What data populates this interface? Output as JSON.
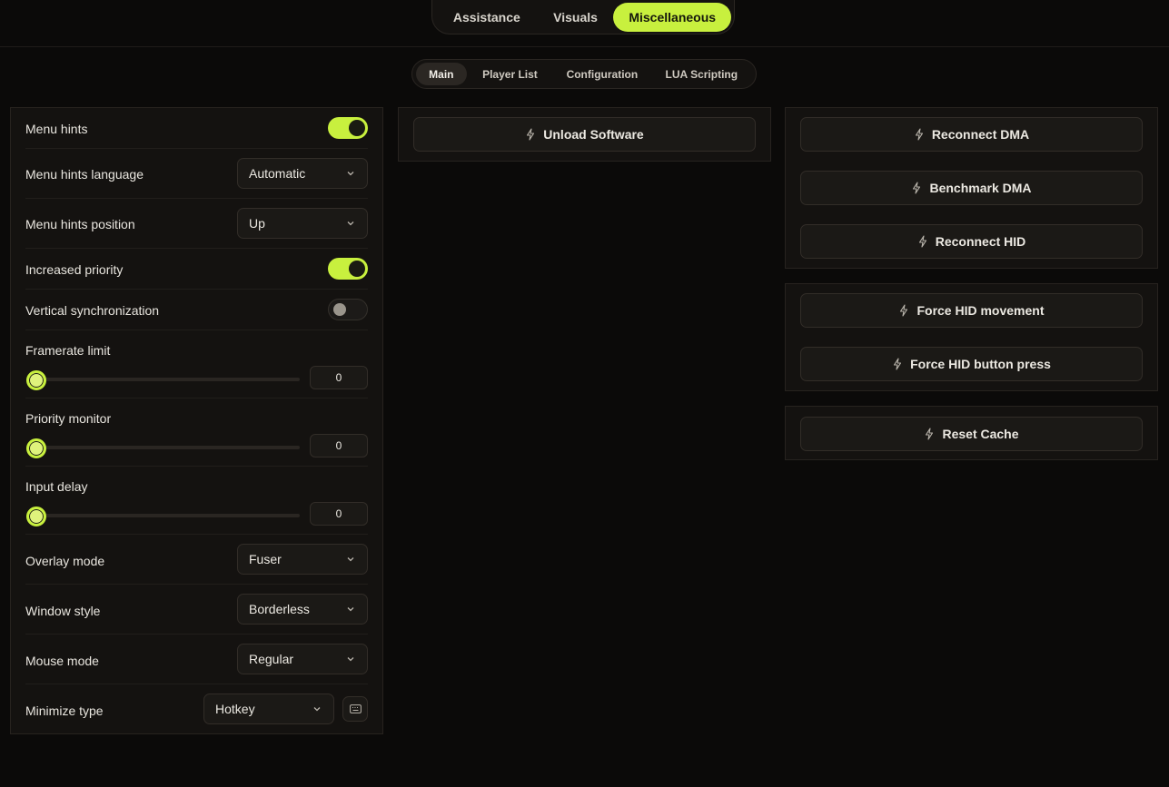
{
  "topnav": {
    "tabs": [
      {
        "label": "Assistance"
      },
      {
        "label": "Visuals"
      },
      {
        "label": "Miscellaneous",
        "active": true
      }
    ]
  },
  "subnav": {
    "tabs": [
      {
        "label": "Main",
        "active": true
      },
      {
        "label": "Player List"
      },
      {
        "label": "Configuration"
      },
      {
        "label": "LUA Scripting"
      }
    ]
  },
  "settings": {
    "menu_hints": {
      "label": "Menu hints",
      "enabled": true
    },
    "menu_hints_language": {
      "label": "Menu hints language",
      "value": "Automatic"
    },
    "menu_hints_position": {
      "label": "Menu hints position",
      "value": "Up"
    },
    "increased_priority": {
      "label": "Increased priority",
      "enabled": true
    },
    "vertical_sync": {
      "label": "Vertical synchronization",
      "enabled": false
    },
    "framerate_limit": {
      "label": "Framerate limit",
      "value": "0"
    },
    "priority_monitor": {
      "label": "Priority monitor",
      "value": "0"
    },
    "input_delay": {
      "label": "Input delay",
      "value": "0"
    },
    "overlay_mode": {
      "label": "Overlay mode",
      "value": "Fuser"
    },
    "window_style": {
      "label": "Window style",
      "value": "Borderless"
    },
    "mouse_mode": {
      "label": "Mouse mode",
      "value": "Regular"
    },
    "minimize_type": {
      "label": "Minimize type",
      "value": "Hotkey"
    }
  },
  "actions": {
    "unload_software": "Unload Software",
    "reconnect_dma": "Reconnect DMA",
    "benchmark_dma": "Benchmark DMA",
    "reconnect_hid": "Reconnect HID",
    "force_hid_movement": "Force HID movement",
    "force_hid_button_press": "Force HID button press",
    "reset_cache": "Reset Cache"
  },
  "colors": {
    "accent": "#c8f03e",
    "background": "#0b0a09",
    "panel": "#141210"
  },
  "icons": {
    "action": "lightning-bolt-icon",
    "dropdown": "chevron-down-icon",
    "hotkey": "keyboard-icon"
  }
}
